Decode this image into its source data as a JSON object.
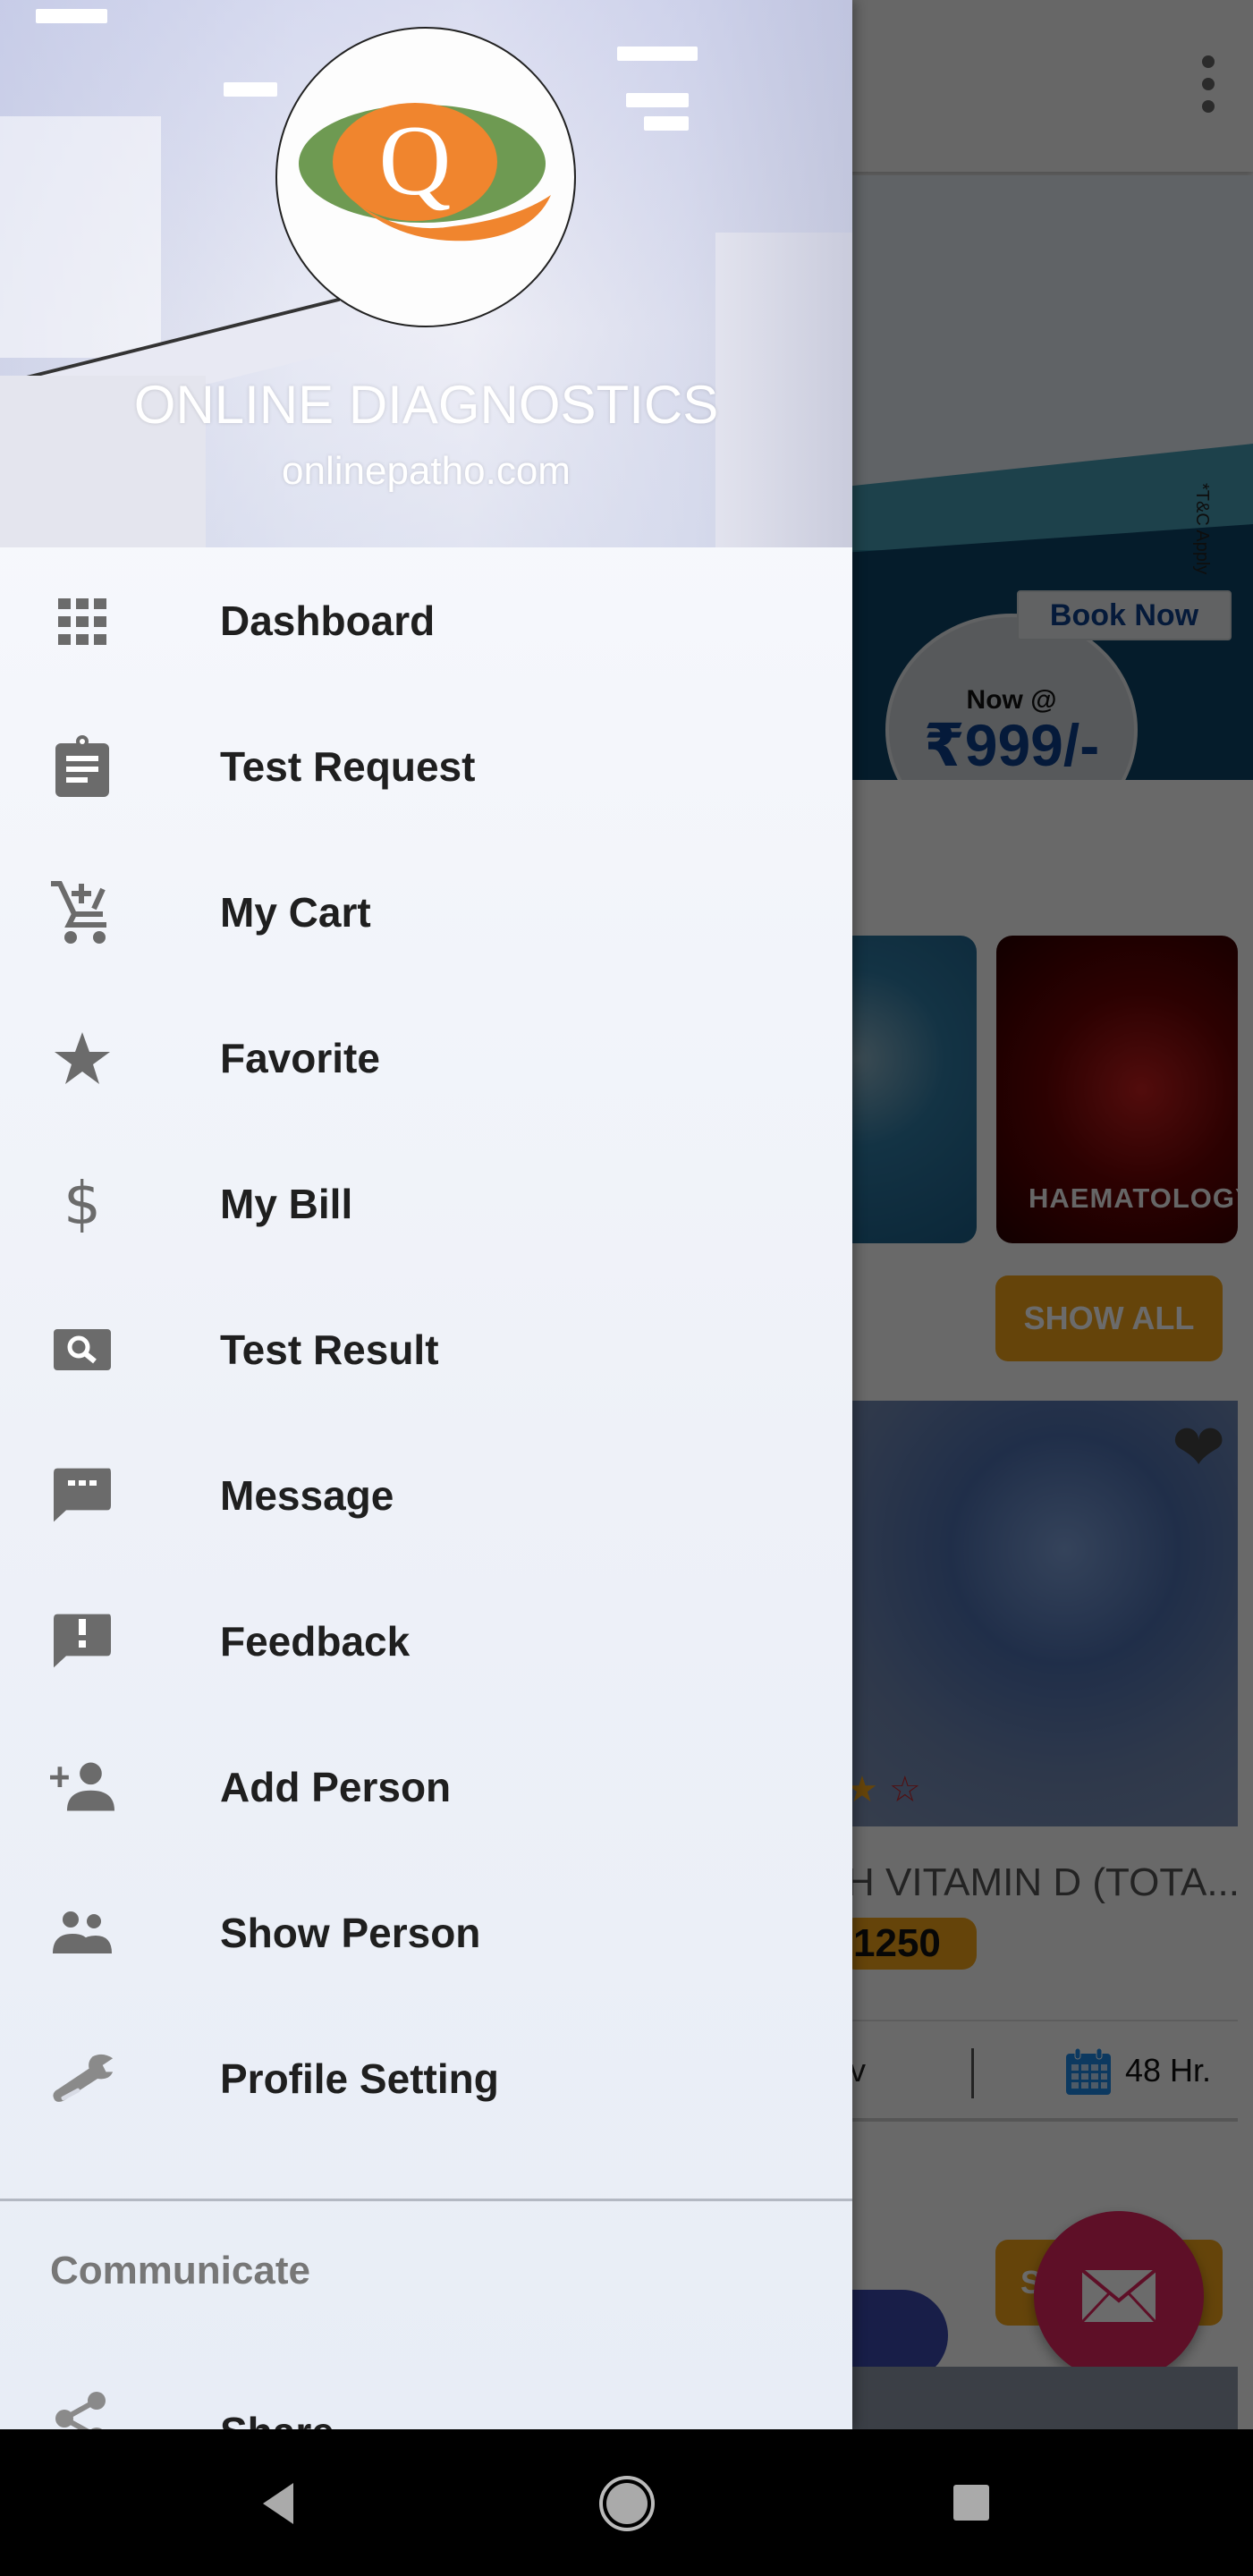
{
  "app": {
    "title": "ONLINE DIAGNOSTICS",
    "subtitle": "onlinepatho.com",
    "logo_letter": "Q",
    "logo_colors": {
      "green": "#6e9a52",
      "orange": "#f0852e"
    }
  },
  "drawer": {
    "menu_items": [
      {
        "label": "Dashboard",
        "icon": "grid-icon"
      },
      {
        "label": "Test Request",
        "icon": "clipboard-icon"
      },
      {
        "label": "My Cart",
        "icon": "add-cart-icon"
      },
      {
        "label": "Favorite",
        "icon": "star-icon"
      },
      {
        "label": "My Bill",
        "icon": "dollar-icon"
      },
      {
        "label": "Test Result",
        "icon": "search-icon"
      },
      {
        "label": "Message",
        "icon": "chat-icon"
      },
      {
        "label": "Feedback",
        "icon": "feedback-icon"
      },
      {
        "label": "Add Person",
        "icon": "person-add-icon"
      },
      {
        "label": "Show Person",
        "icon": "people-icon"
      },
      {
        "label": "Profile Setting",
        "icon": "wrench-icon"
      }
    ],
    "section_label": "Communicate",
    "section_items": [
      {
        "label": "Share",
        "icon": "share-icon"
      }
    ],
    "icon_color": "#6b6b6b"
  },
  "background_app": {
    "banner": {
      "now_label": "Now @",
      "price": "₹999/-",
      "terms": "*T&C Apply",
      "book_button": "Book Now"
    },
    "categories": [
      {
        "label": ""
      },
      {
        "label": "HAEMATOLOGY"
      }
    ],
    "show_all_label": "SHOW ALL",
    "product": {
      "title": "H VITAMIN D (TOTA...",
      "price": "1250",
      "left_info": "v",
      "turnaround": "48 Hr."
    },
    "second_button_label": "S",
    "accent_color": "#f0a319",
    "fab_color": "#e0245e"
  },
  "nav_bar": {
    "back": "back-icon",
    "home": "home-icon",
    "recents": "recents-icon"
  }
}
